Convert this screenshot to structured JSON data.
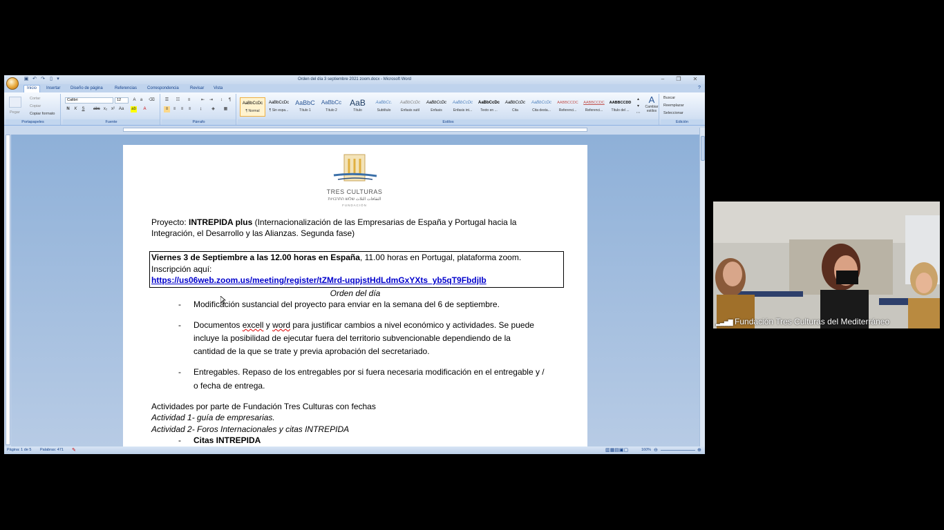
{
  "window": {
    "title": "Orden del día 3 septiembre 2021 zoom.docx - Microsoft Word"
  },
  "tabs": [
    "Inicio",
    "Insertar",
    "Diseño de página",
    "Referencias",
    "Correspondencia",
    "Revisar",
    "Vista"
  ],
  "ribbon": {
    "clipboard": {
      "paste": "Pegar",
      "cut": "Cortar",
      "copy": "Copiar",
      "format_painter": "Copiar formato",
      "label": "Portapapeles"
    },
    "font": {
      "name": "Calibri",
      "size": "12",
      "label": "Fuente"
    },
    "paragraph": {
      "label": "Párrafo"
    },
    "styles": {
      "label": "Estilos",
      "items": [
        {
          "preview": "AaBbCcDc",
          "name": "¶ Normal"
        },
        {
          "preview": "AaBbCcDc",
          "name": "¶ Sin espa..."
        },
        {
          "preview": "AaBbC",
          "name": "Título 1"
        },
        {
          "preview": "AaBbCc",
          "name": "Título 2"
        },
        {
          "preview": "AaB",
          "name": "Título"
        },
        {
          "preview": "AaBbCc.",
          "name": "Subtítulo"
        },
        {
          "preview": "AaBbCcDc",
          "name": "Énfasis sutil"
        },
        {
          "preview": "AaBbCcDc",
          "name": "Énfasis"
        },
        {
          "preview": "AaBbCcDc",
          "name": "Énfasis int..."
        },
        {
          "preview": "AaBbCcDc",
          "name": "Texto en ..."
        },
        {
          "preview": "AaBbCcDc",
          "name": "Cita"
        },
        {
          "preview": "AaBbCcDc",
          "name": "Cita desta..."
        },
        {
          "preview": "AABBCCDC",
          "name": "Referenci..."
        },
        {
          "preview": "AABBCCDC",
          "name": "Referenci..."
        },
        {
          "preview": "AABBCCDD",
          "name": "Título del ..."
        }
      ],
      "change_styles": "Cambiar estilos"
    },
    "editing": {
      "find": "Buscar",
      "replace": "Reemplazar",
      "select": "Seleccionar",
      "label": "Edición"
    }
  },
  "document": {
    "logo_text": "TRES CULTURAS",
    "logo_sub": "الثقافات الثلاث  שלוש התרבויות",
    "logo_foot": "FUNDACIÓN",
    "project_prefix": "Proyecto: ",
    "project_name": "INTREPIDA plus",
    "project_desc_1": "  (Internacionalización de las Empresarias de España y Portugal hacia la",
    "project_desc_2": "Integración, el Desarrollo y las Alianzas. Segunda fase)",
    "meeting_bold": "Viernes 3 de Septiembre a las 12.00 horas en España",
    "meeting_rest": ", 11.00 horas en Portugal, plataforma zoom.",
    "inscription": "Inscripción aquí:",
    "link": "https://us06web.zoom.us/meeting/register/tZMrd-uqpjstHdLdmGxYXts_yb5qT9FbdjIb",
    "agenda_title": "Orden del día",
    "bullet1": "Modificación sustancial del proyecto para enviar en la semana del 6 de septiembre.",
    "bullet2_a": "Documentos ",
    "bullet2_excell": "excell",
    "bullet2_b": " y ",
    "bullet2_word": "word",
    "bullet2_c": " para justificar cambios a nivel económico y actividades. Se puede",
    "bullet2_line2": "incluye la posibilidad de ejecutar fuera del territorio subvencionable dependiendo de la",
    "bullet2_line3": "cantidad de la que se trate y previa aprobación del secretariado.",
    "bullet3_line1": "Entregables. Repaso de los entregables por si fuera necesaria modificación en el entregable y /",
    "bullet3_line2": "o fecha de entrega.",
    "activities": "Actividades por parte de Fundación Tres Culturas con fechas",
    "activity1": "Actividad 1- guía de empresarias.",
    "activity2": "Actividad 2- Foros Internacionales y citas INTREPIDA",
    "sub_bullet": "Citas INTREPIDA",
    "dash": "-"
  },
  "status": {
    "page": "Página: 1 de 5",
    "words": "Palabras: 471",
    "zoom": "160%"
  },
  "video": {
    "participant": "Fundación Tres Culturas del Mediterráneo"
  }
}
